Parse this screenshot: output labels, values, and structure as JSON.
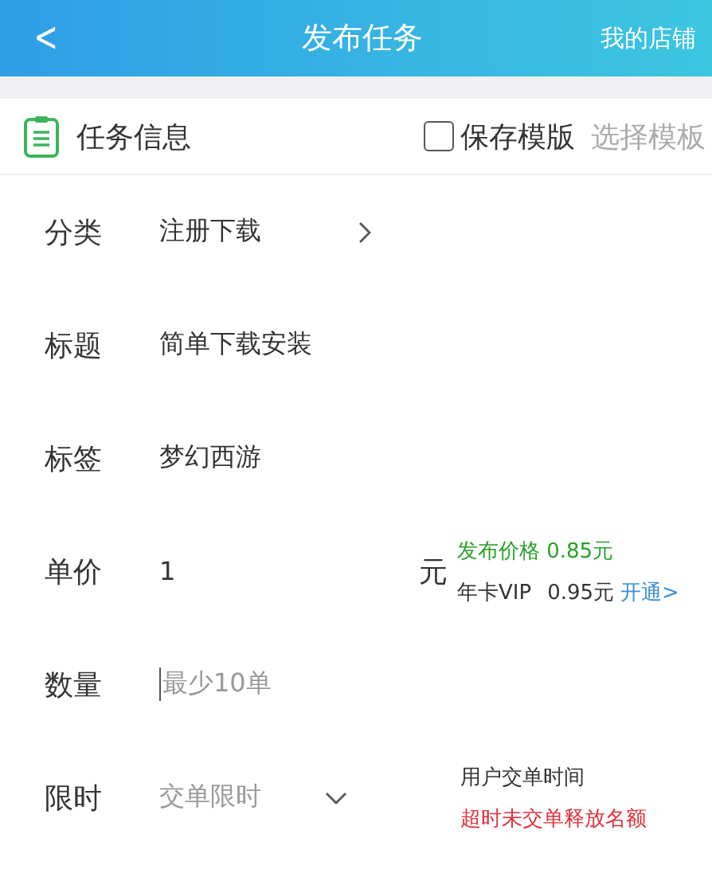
{
  "header": {
    "back": "<",
    "title": "发布任务",
    "action": "我的店铺"
  },
  "section": {
    "title": "任务信息",
    "save_template": {
      "label": "保存模版",
      "checked": false
    },
    "choose_template": "选择模板"
  },
  "rows": [
    {
      "kind": "select",
      "label": "分类",
      "value": "注册下载"
    },
    {
      "kind": "text",
      "label": "标题",
      "value": "简单下载安装"
    },
    {
      "kind": "text",
      "label": "标签",
      "value": "梦幻西游"
    },
    {
      "kind": "price",
      "label": "单价",
      "value": "1",
      "unit": "元",
      "publish_price": "发布价格 0.85元",
      "vip_label": "年卡VIP",
      "vip_price": "0.95元",
      "vip_link": "开通>"
    },
    {
      "kind": "input",
      "label": "数量",
      "placeholder": "最少10单"
    },
    {
      "kind": "dropdown",
      "label": "限时",
      "placeholder": "交单限时",
      "note": "用户交单时间",
      "warning": "超时未交单释放名额"
    }
  ]
}
